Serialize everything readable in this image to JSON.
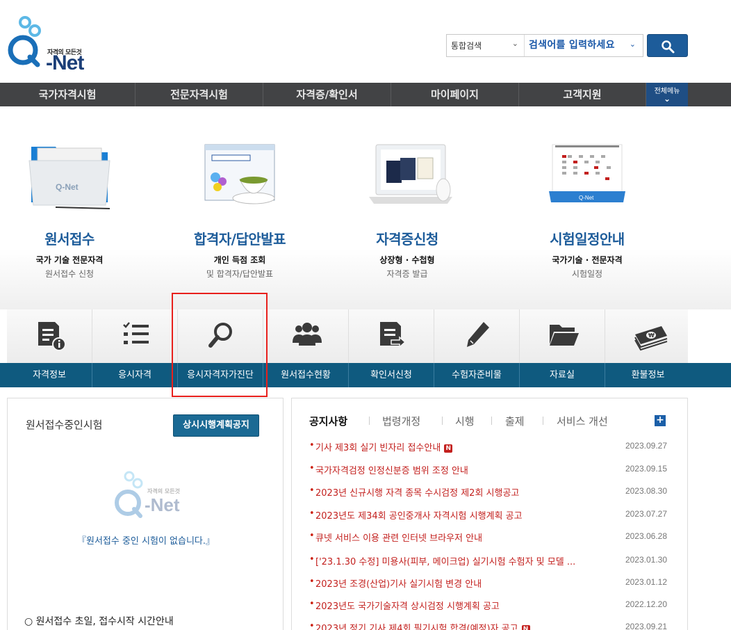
{
  "header": {
    "logo_sub": "자격의 모든것",
    "logo_text": "Q-Net",
    "search_scope": "통합검색",
    "search_placeholder": "검색어를 입력하세요"
  },
  "gnb": {
    "items": [
      "국가자격시험",
      "전문자격시험",
      "자격증/확인서",
      "마이페이지",
      "고객지원"
    ],
    "all_menu": "전체메뉴"
  },
  "hero": [
    {
      "title": "원서접수",
      "sub1": "국가 기술 전문자격",
      "sub2": "원서접수 신청"
    },
    {
      "title": "합격자/답안발표",
      "sub1": "개인 득점 조회",
      "sub2": "및 합격자/답안발표"
    },
    {
      "title": "자격증신청",
      "sub1": "상장형 · 수첩형",
      "sub2": "자격증 발급"
    },
    {
      "title": "시험일정안내",
      "sub1": "국가기술 · 전문자격",
      "sub2": "시험일정"
    }
  ],
  "quick": [
    "자격정보",
    "응시자격",
    "응시자격자가진단",
    "원서접수현황",
    "확인서신청",
    "수험자준비물",
    "자료실",
    "환불정보"
  ],
  "left_panel": {
    "title": "원서접수중인시험",
    "button": "상시시행계획공지",
    "empty_message": "『원서접수 중인 시험이 없습니다.』",
    "info": "○ 원서접수 초일, 접수시작 시간안내"
  },
  "right_panel": {
    "tabs": [
      "공지사항",
      "법령개정",
      "시행",
      "출제",
      "서비스 개선"
    ],
    "notices": [
      {
        "title": "기사 제3회 실기 빈자리 접수안내",
        "new": "N",
        "date": "2023.09.27"
      },
      {
        "title": "국가자격검정 인정신분증 범위 조정 안내",
        "new": "",
        "date": "2023.09.15"
      },
      {
        "title": "2023년 신규시행 자격 종목 수시검정 제2회 시행공고",
        "new": "",
        "date": "2023.08.30"
      },
      {
        "title": "2023년도 제34회 공인중개사 자격시험 시행계획 공고",
        "new": "",
        "date": "2023.07.27"
      },
      {
        "title": "큐넷 서비스 이용 관련 인터넷 브라우저 안내",
        "new": "",
        "date": "2023.06.28"
      },
      {
        "title": "['23.1.30 수정] 미용사(피부, 메이크업) 실기시험 수험자 및 모델 ...",
        "new": "",
        "date": "2023.01.30"
      },
      {
        "title": "2023년 조경(산업)기사 실기시험 변경 안내",
        "new": "",
        "date": "2023.01.12"
      },
      {
        "title": "2023년도 국가기술자격 상시검정 시행계획 공고",
        "new": "",
        "date": "2022.12.20"
      },
      {
        "title": "2023년 정기 기사 제4회 필기시험 합격(예정)자 공고",
        "new": "N",
        "date": "2023.09.21"
      }
    ]
  },
  "colors": {
    "brand": "#1d5c9a",
    "nav": "#424345",
    "quickbar": "#0f5a7f",
    "notice": "#c3201e",
    "highlight": "#e8201c"
  }
}
